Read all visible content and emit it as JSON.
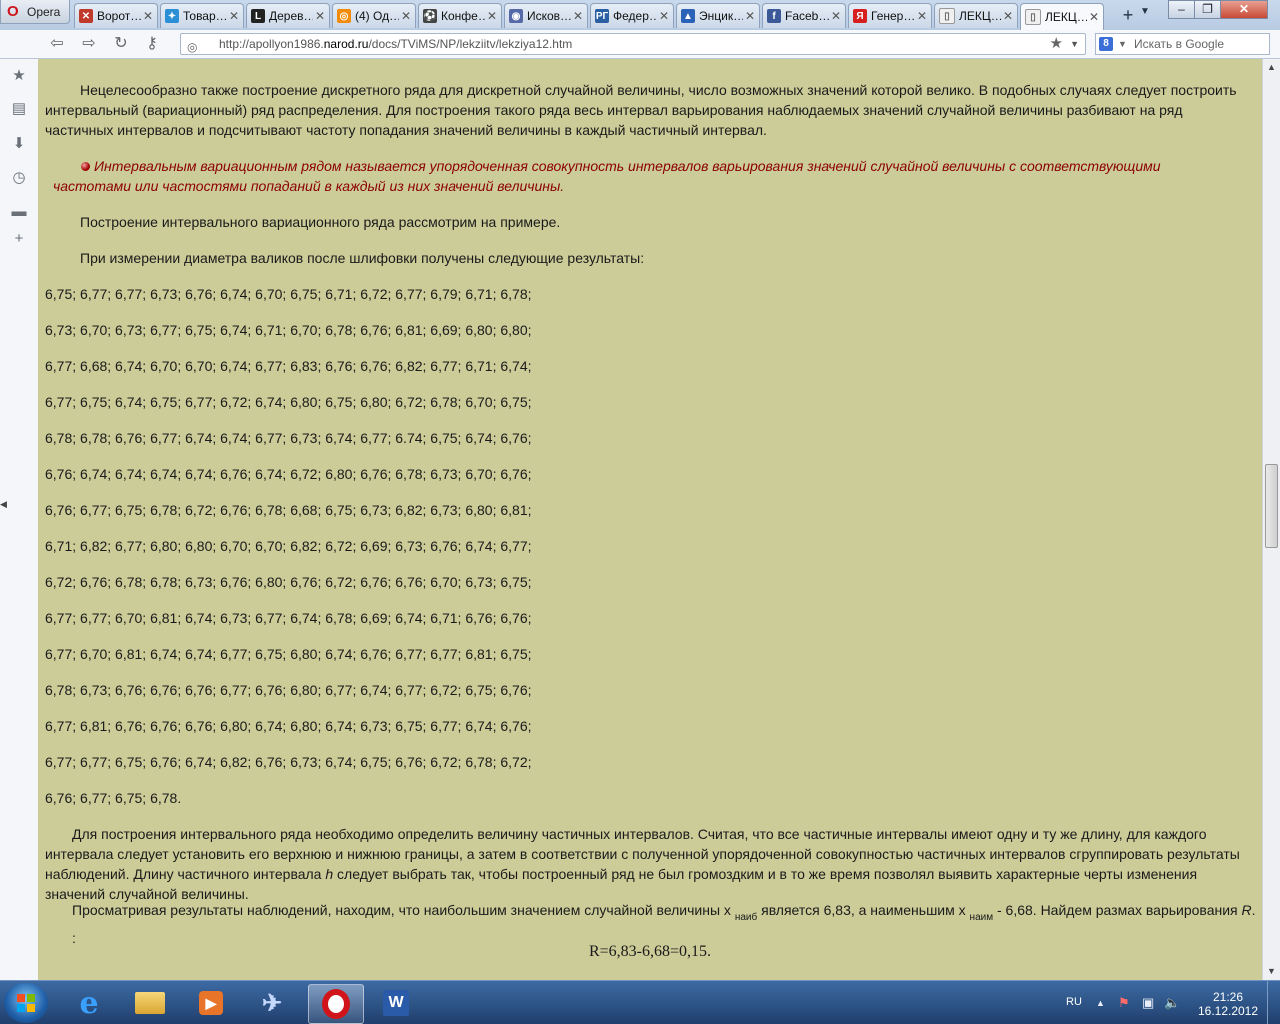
{
  "browser": {
    "menu_label": "Opera",
    "tabs": [
      {
        "title": "Ворот…",
        "favicon": "news-icon"
      },
      {
        "title": "Товар…",
        "favicon": "shop-icon"
      },
      {
        "title": "Дерев…",
        "favicon": "l-logo-icon"
      },
      {
        "title": "(4) Од…",
        "favicon": "odnoklassniki-icon"
      },
      {
        "title": "Конфе…",
        "favicon": "conference-icon"
      },
      {
        "title": "Исков…",
        "favicon": "search-site-icon"
      },
      {
        "title": "Федер…",
        "favicon": "rg-icon"
      },
      {
        "title": "Энцик…",
        "favicon": "encyclopedia-icon"
      },
      {
        "title": "Faceb…",
        "favicon": "facebook-icon"
      },
      {
        "title": "Генер…",
        "favicon": "yandex-icon"
      },
      {
        "title": "ЛЕКЦ…",
        "favicon": "page-icon"
      },
      {
        "title": "ЛЕКЦ…",
        "favicon": "page-icon"
      }
    ],
    "address": {
      "prefix": "http://apollyon1986.",
      "domain": "narod.ru",
      "path": "/docs/TViMS/NP/lekziitv/lekziya12.htm"
    },
    "search_placeholder": "Искать в Google"
  },
  "content": {
    "para1": "Нецелесообразно также построение дискретного ряда для дискретной случайной величины, число возможных значений которой велико. В подобных случаях следует построить интервальный (вариационный) ряд распределения. Для построения такого ряда весь интервал варьирования наблюдаемых значений случайной величины разбивают на ряд частичных интервалов и подсчитывают частоту попадания значений величины в каждый частичный интервал.",
    "definition": "Интервальным вариационным рядом называется упорядоченная совокупность интервалов варьирования значений случайной величины с соответствующими частотами или частостями попаданий в каждый из них значений величины.",
    "para2": "Построение интервального вариационного ряда рассмотрим на примере.",
    "para3": "При измерении диаметра валиков после шлифовки получены следующие результаты:",
    "data_rows": [
      "6,75; 6,77; 6,77; 6,73; 6,76; 6,74; 6,70; 6,75; 6,71; 6,72; 6,77; 6,79; 6,71; 6,78;",
      "6,73; 6,70; 6,73; 6,77; 6,75; 6,74; 6,71; 6,70; 6,78; 6,76; 6,81; 6,69; 6,80; 6,80;",
      "6,77; 6,68; 6,74; 6,70; 6,70; 6,74; 6,77; 6,83; 6,76; 6,76; 6,82; 6,77; 6,71; 6,74;",
      "6,77; 6,75; 6,74; 6,75; 6,77; 6,72; 6,74; 6,80; 6,75; 6,80; 6,72; 6,78; 6,70; 6,75;",
      "6,78; 6,78; 6,76; 6,77; 6,74; 6,74; 6,77; 6,73; 6,74; 6,77; 6.74; 6,75; 6,74; 6,76;",
      "6,76; 6,74; 6,74; 6,74; 6,74; 6,76; 6,74; 6,72; 6,80; 6,76; 6,78; 6,73; 6,70; 6,76;",
      "6,76; 6,77; 6,75; 6,78; 6,72; 6,76; 6,78; 6,68; 6,75; 6,73; 6,82; 6,73; 6,80; 6,81;",
      "6,71; 6,82; 6,77; 6,80; 6,80; 6,70; 6,70; 6,82; 6,72; 6,69; 6,73; 6,76; 6,74; 6,77;",
      "6,72; 6,76; 6,78; 6,78; 6,73; 6,76; 6,80; 6,76; 6,72; 6,76; 6,76; 6,70; 6,73; 6,75;",
      "6,77; 6,77; 6,70; 6,81; 6,74; 6,73; 6,77; 6,74; 6,78; 6,69; 6,74; 6,71; 6,76; 6,76;",
      "6,77; 6,70; 6,81; 6,74; 6,74; 6,77; 6,75; 6,80; 6,74; 6,76; 6,77; 6,77; 6,81; 6,75;",
      "6,78; 6,73; 6,76; 6,76; 6,76; 6,77; 6,76; 6,80; 6,77; 6,74; 6,77; 6,72; 6,75; 6,76;",
      "6,77; 6,81; 6,76; 6,76; 6,76; 6,80; 6,74; 6,80; 6,74; 6,73; 6,75; 6,77; 6,74; 6,76;",
      "6,77; 6,77; 6,75; 6,76; 6,74; 6,82; 6,76; 6,73; 6,74; 6,75; 6,76; 6,72; 6,78; 6,72;",
      "6,76; 6,77; 6,75; 6,78."
    ],
    "para4_a": "Для построения интервального ряда необходимо определить величину частичных интервалов. Считая, что все частичные интервалы имеют одну и ту же длину, для каждого интервала следует установить его верхнюю и нижнюю границы, а затем в соответствии с полученной упорядоченной совокупностью частичных интервалов сгруппировать результаты наблюдений. Длину частичного интервала ",
    "para4_h": "h",
    "para4_b": " следует выбрать так, чтобы построенный ряд не был громоздким и в то же время позволял выявить характерные черты изменения значений случайной величины.",
    "para5_a": "Просматривая результаты наблюдений, находим, что наибольшим значением случайной величины х ",
    "para5_sub1": "наиб",
    "para5_b": " является 6,83, а наименьшим  х ",
    "para5_sub2": "наим",
    "para5_c": " - 6,68. Найдем размах варьирования ",
    "para5_R": "R",
    "para5_d": ". :",
    "formula": "R=6,83-6,68=0,15."
  },
  "taskbar": {
    "lang": "RU",
    "time": "21:26",
    "date": "16.12.2012"
  },
  "colors": {
    "page_bg": "#cccc99",
    "definition_text": "#8b0000"
  }
}
